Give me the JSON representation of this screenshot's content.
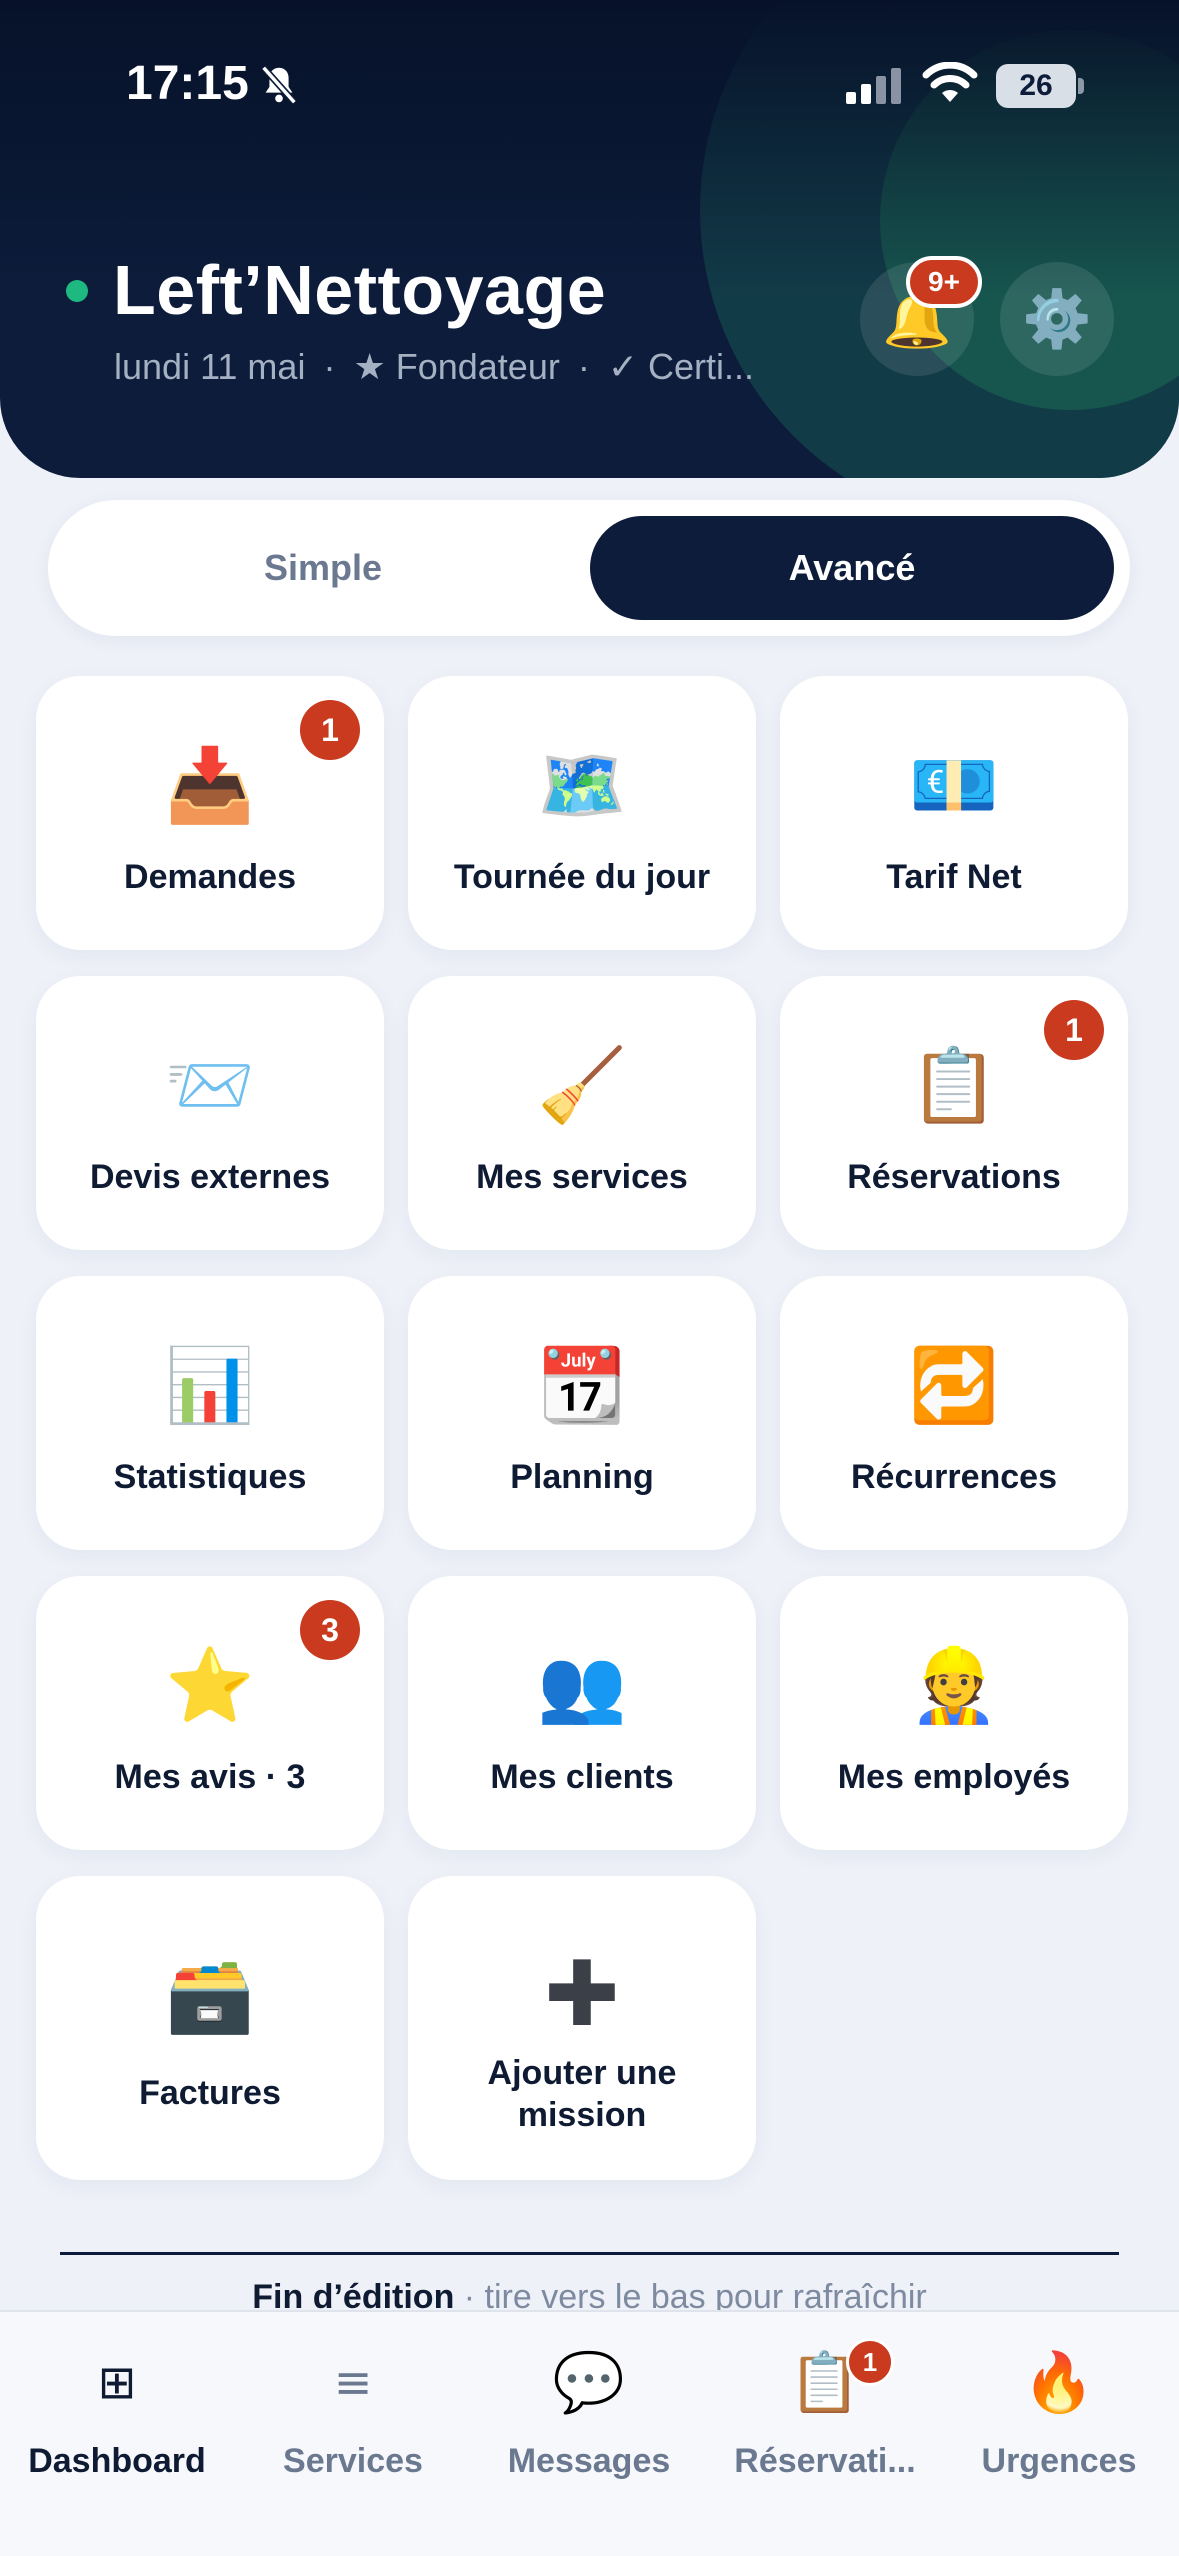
{
  "status_bar": {
    "time": "17:15",
    "battery": "26"
  },
  "header": {
    "title": "Left’Nettoyage",
    "date": "lundi 11 mai",
    "role": "★ Fondateur",
    "certified": "✓ Certi...",
    "separator": "·",
    "notifications_badge": "9+",
    "accent_color": "#1eb981",
    "bg_color": "#0c1c3a"
  },
  "mode_toggle": {
    "simple": "Simple",
    "advanced": "Avancé",
    "selected": "Avancé"
  },
  "tiles": [
    {
      "icon": "📥",
      "label": "Demandes",
      "badge": "1"
    },
    {
      "icon": "🗺️",
      "label": "Tournée du jour",
      "badge": ""
    },
    {
      "icon": "💶",
      "label": "Tarif Net",
      "badge": ""
    },
    {
      "icon": "📨",
      "label": "Devis externes",
      "badge": ""
    },
    {
      "icon": "🧹",
      "label": "Mes services",
      "badge": ""
    },
    {
      "icon": "📋",
      "label": "Réservations",
      "badge": "1"
    },
    {
      "icon": "📊",
      "label": "Statistiques",
      "badge": ""
    },
    {
      "icon": "📆",
      "label": "Planning",
      "badge": ""
    },
    {
      "icon": "🔁",
      "label": "Récurrences",
      "badge": ""
    },
    {
      "icon": "⭐",
      "label": "Mes avis · 3",
      "badge": "3"
    },
    {
      "icon": "👥",
      "label": "Mes clients",
      "badge": ""
    },
    {
      "icon": "👷",
      "label": "Mes employés",
      "badge": ""
    },
    {
      "icon": "🗃️",
      "label": "Factures",
      "badge": ""
    },
    {
      "icon": "✚",
      "label": "Ajouter une mission",
      "badge": ""
    }
  ],
  "footer_note": {
    "strong": "Fin d’édition",
    "weak": " · tire vers le bas pour rafraîchir"
  },
  "tabbar": [
    {
      "icon": "⊞",
      "label": "Dashboard",
      "active": true,
      "badge": ""
    },
    {
      "icon": "≡",
      "label": "Services",
      "active": false,
      "badge": ""
    },
    {
      "icon": "💬",
      "label": "Messages",
      "active": false,
      "badge": ""
    },
    {
      "icon": "📋",
      "label": "Réservati...",
      "active": false,
      "badge": "1"
    },
    {
      "icon": "🔥",
      "label": "Urgences",
      "active": false,
      "badge": ""
    }
  ]
}
